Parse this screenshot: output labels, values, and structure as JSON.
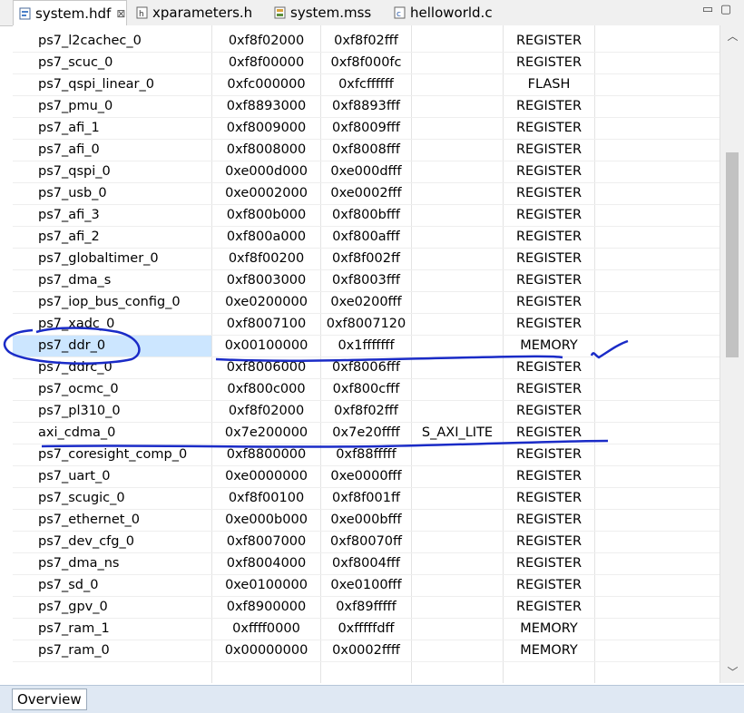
{
  "tabs": [
    {
      "label": "system.hdf",
      "icon": "hdf-file-icon",
      "active": true
    },
    {
      "label": "xparameters.h",
      "icon": "c-header-file-icon",
      "active": false
    },
    {
      "label": "system.mss",
      "icon": "mss-file-icon",
      "active": false
    },
    {
      "label": "helloworld.c",
      "icon": "c-source-file-icon",
      "active": false
    }
  ],
  "window_controls": {
    "close_tab": "⊠",
    "minimize": "▭",
    "maximize": "▢"
  },
  "rows": [
    {
      "name": "ps7_l2cachec_0",
      "base": "0xf8f02000",
      "high": "0xf8f02fff",
      "slave": "",
      "type": "REGISTER"
    },
    {
      "name": "ps7_scuc_0",
      "base": "0xf8f00000",
      "high": "0xf8f000fc",
      "slave": "",
      "type": "REGISTER"
    },
    {
      "name": "ps7_qspi_linear_0",
      "base": "0xfc000000",
      "high": "0xfcffffff",
      "slave": "",
      "type": "FLASH"
    },
    {
      "name": "ps7_pmu_0",
      "base": "0xf8893000",
      "high": "0xf8893fff",
      "slave": "",
      "type": "REGISTER"
    },
    {
      "name": "ps7_afi_1",
      "base": "0xf8009000",
      "high": "0xf8009fff",
      "slave": "",
      "type": "REGISTER"
    },
    {
      "name": "ps7_afi_0",
      "base": "0xf8008000",
      "high": "0xf8008fff",
      "slave": "",
      "type": "REGISTER"
    },
    {
      "name": "ps7_qspi_0",
      "base": "0xe000d000",
      "high": "0xe000dfff",
      "slave": "",
      "type": "REGISTER"
    },
    {
      "name": "ps7_usb_0",
      "base": "0xe0002000",
      "high": "0xe0002fff",
      "slave": "",
      "type": "REGISTER"
    },
    {
      "name": "ps7_afi_3",
      "base": "0xf800b000",
      "high": "0xf800bfff",
      "slave": "",
      "type": "REGISTER"
    },
    {
      "name": "ps7_afi_2",
      "base": "0xf800a000",
      "high": "0xf800afff",
      "slave": "",
      "type": "REGISTER"
    },
    {
      "name": "ps7_globaltimer_0",
      "base": "0xf8f00200",
      "high": "0xf8f002ff",
      "slave": "",
      "type": "REGISTER"
    },
    {
      "name": "ps7_dma_s",
      "base": "0xf8003000",
      "high": "0xf8003fff",
      "slave": "",
      "type": "REGISTER"
    },
    {
      "name": "ps7_iop_bus_config_0",
      "base": "0xe0200000",
      "high": "0xe0200fff",
      "slave": "",
      "type": "REGISTER"
    },
    {
      "name": "ps7_xadc_0",
      "base": "0xf8007100",
      "high": "0xf8007120",
      "slave": "",
      "type": "REGISTER"
    },
    {
      "name": "ps7_ddr_0",
      "base": "0x00100000",
      "high": "0x1fffffff",
      "slave": "",
      "type": "MEMORY",
      "selected": true
    },
    {
      "name": "ps7_ddrc_0",
      "base": "0xf8006000",
      "high": "0xf8006fff",
      "slave": "",
      "type": "REGISTER"
    },
    {
      "name": "ps7_ocmc_0",
      "base": "0xf800c000",
      "high": "0xf800cfff",
      "slave": "",
      "type": "REGISTER"
    },
    {
      "name": "ps7_pl310_0",
      "base": "0xf8f02000",
      "high": "0xf8f02fff",
      "slave": "",
      "type": "REGISTER"
    },
    {
      "name": "axi_cdma_0",
      "base": "0x7e200000",
      "high": "0x7e20ffff",
      "slave": "S_AXI_LITE",
      "type": "REGISTER"
    },
    {
      "name": "ps7_coresight_comp_0",
      "base": "0xf8800000",
      "high": "0xf88fffff",
      "slave": "",
      "type": "REGISTER"
    },
    {
      "name": "ps7_uart_0",
      "base": "0xe0000000",
      "high": "0xe0000fff",
      "slave": "",
      "type": "REGISTER"
    },
    {
      "name": "ps7_scugic_0",
      "base": "0xf8f00100",
      "high": "0xf8f001ff",
      "slave": "",
      "type": "REGISTER"
    },
    {
      "name": "ps7_ethernet_0",
      "base": "0xe000b000",
      "high": "0xe000bfff",
      "slave": "",
      "type": "REGISTER"
    },
    {
      "name": "ps7_dev_cfg_0",
      "base": "0xf8007000",
      "high": "0xf80070ff",
      "slave": "",
      "type": "REGISTER"
    },
    {
      "name": "ps7_dma_ns",
      "base": "0xf8004000",
      "high": "0xf8004fff",
      "slave": "",
      "type": "REGISTER"
    },
    {
      "name": "ps7_sd_0",
      "base": "0xe0100000",
      "high": "0xe0100fff",
      "slave": "",
      "type": "REGISTER"
    },
    {
      "name": "ps7_gpv_0",
      "base": "0xf8900000",
      "high": "0xf89fffff",
      "slave": "",
      "type": "REGISTER"
    },
    {
      "name": "ps7_ram_1",
      "base": "0xffff0000",
      "high": "0xfffffdff",
      "slave": "",
      "type": "MEMORY"
    },
    {
      "name": "ps7_ram_0",
      "base": "0x00000000",
      "high": "0x0002ffff",
      "slave": "",
      "type": "MEMORY"
    }
  ],
  "bottom_tabs": [
    {
      "label": "Overview",
      "active": true
    }
  ],
  "annotation_color": "#1a2bc7"
}
